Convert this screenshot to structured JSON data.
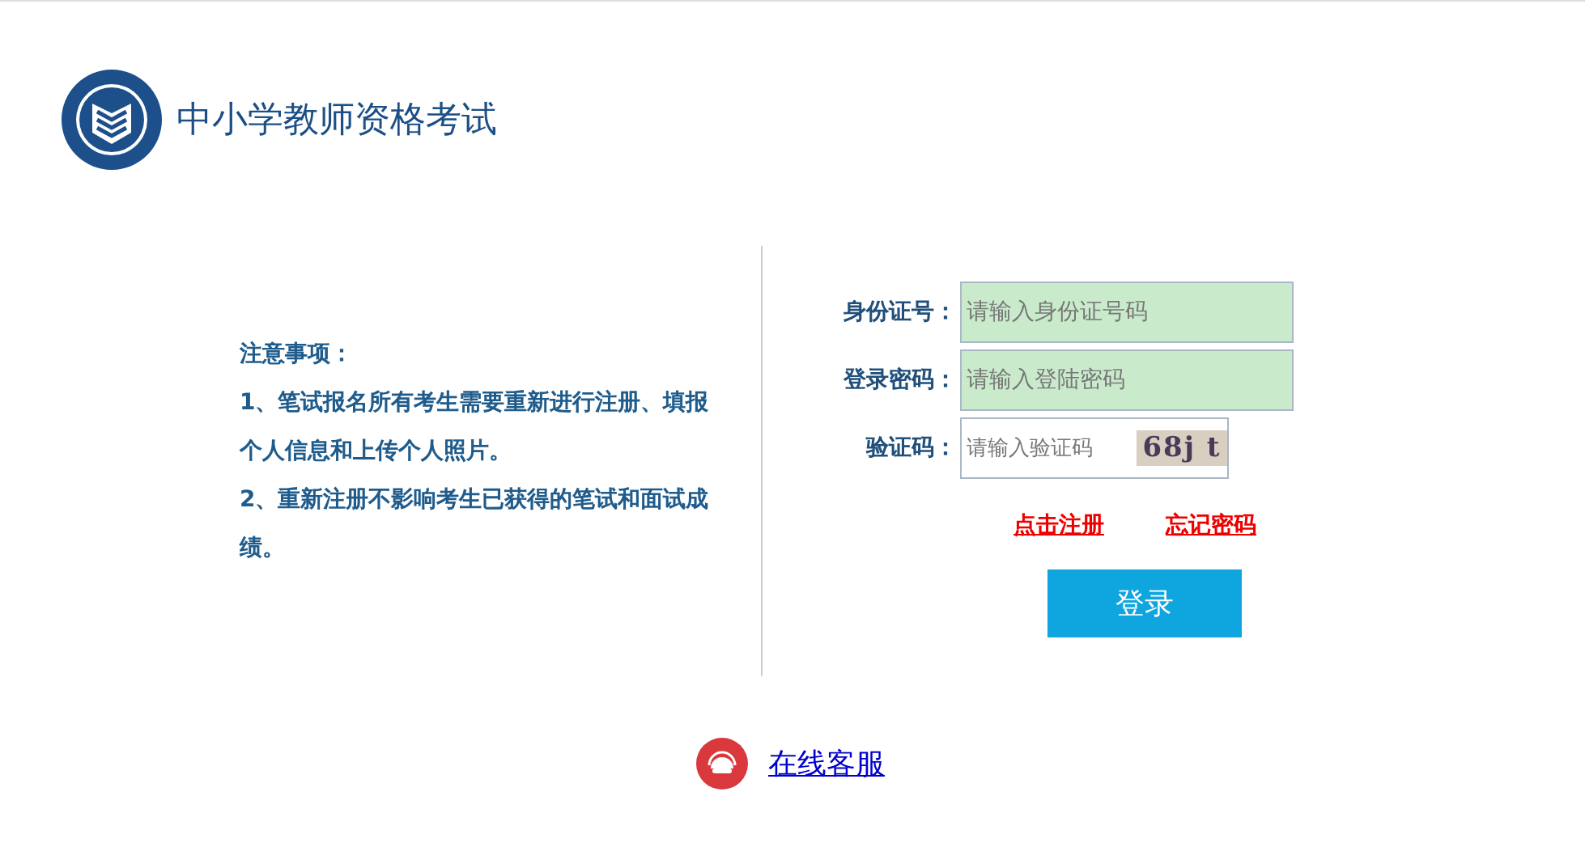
{
  "header": {
    "title": "中小学教师资格考试"
  },
  "notice": {
    "heading": "注意事项：",
    "items": [
      "1、笔试报名所有考生需要重新进行注册、填报个人信息和上传个人照片。",
      "2、重新注册不影响考生已获得的笔试和面试成绩。"
    ]
  },
  "form": {
    "fields": [
      {
        "label": "身份证号：",
        "placeholder": "请输入身份证号码",
        "kind": "text"
      },
      {
        "label": "登录密码：",
        "placeholder": "请输入登陆密码",
        "kind": "password"
      },
      {
        "label": "验证码：",
        "placeholder": "请输入验证码",
        "kind": "captcha",
        "captcha": "68j t"
      }
    ],
    "links": [
      "点击注册",
      "忘记密码"
    ],
    "submit": "登录"
  },
  "footer": {
    "service_link": "在线客服"
  }
}
